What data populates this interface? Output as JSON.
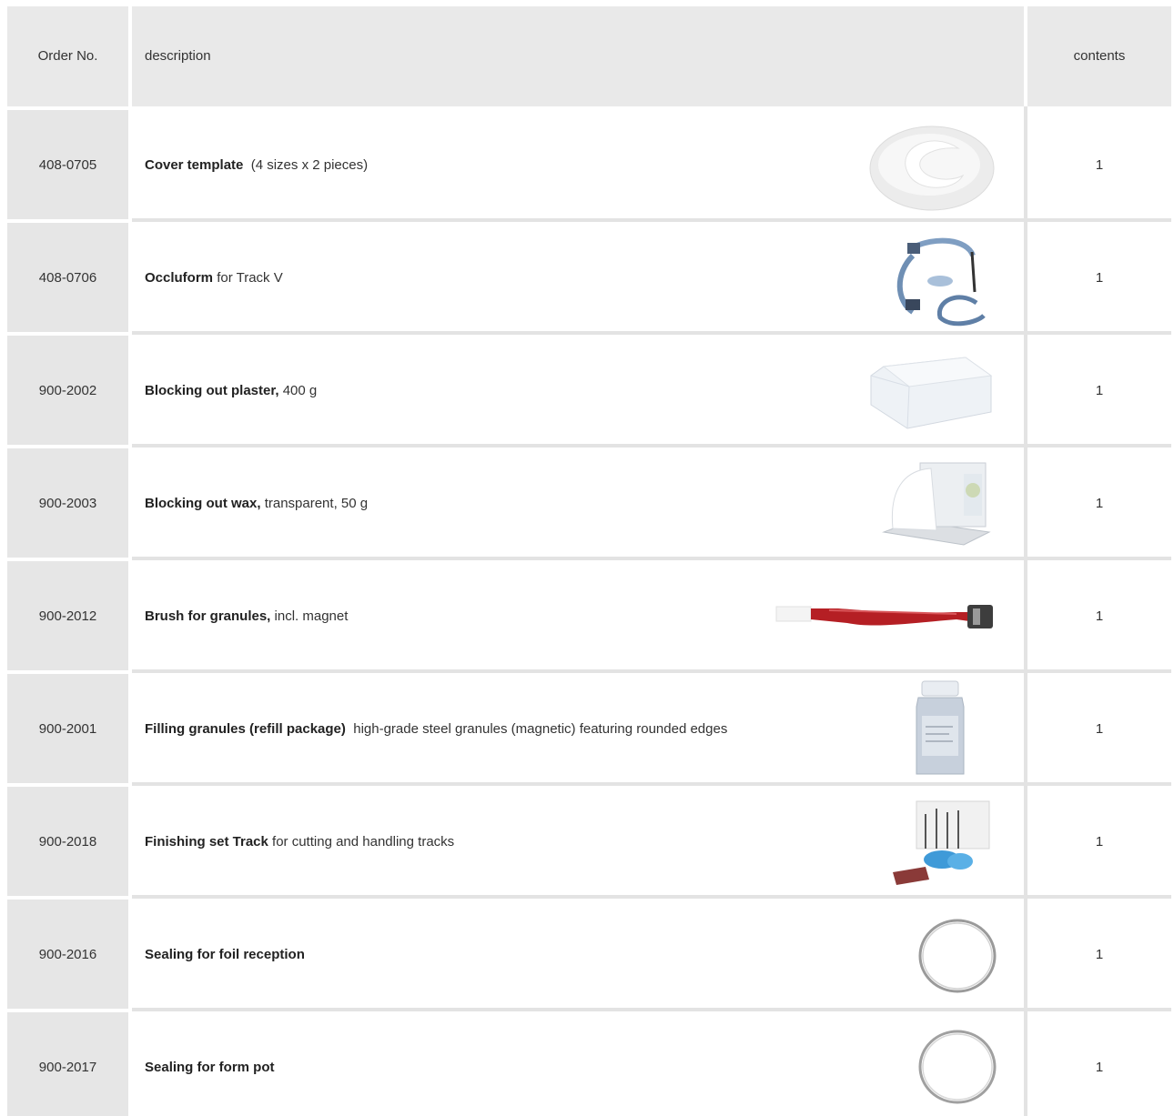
{
  "header": {
    "order_no": "Order No.",
    "description": "description",
    "contents": "contents"
  },
  "rows": [
    {
      "order": "408-0705",
      "name": "Cover template",
      "detail": "(4 sizes x 2 pieces)",
      "qty": "1",
      "image": "cover-template-image"
    },
    {
      "order": "408-0706",
      "name": "Occluform",
      "detail": "for Track V",
      "qty": "1",
      "image": "occluform-image"
    },
    {
      "order": "900-2002",
      "name": "Blocking out plaster,",
      "detail": "400 g",
      "qty": "1",
      "image": "plaster-image"
    },
    {
      "order": "900-2003",
      "name": "Blocking out wax,",
      "detail": "transparent, 50 g",
      "qty": "1",
      "image": "wax-image"
    },
    {
      "order": "900-2012",
      "name": "Brush for granules,",
      "detail": "incl. magnet",
      "qty": "1",
      "image": "brush-image"
    },
    {
      "order": "900-2001",
      "name": "Filling granules (refill package)",
      "detail": "high-grade steel granules (magnetic) featuring rounded edges",
      "qty": "1",
      "image": "granules-bottle-image"
    },
    {
      "order": "900-2018",
      "name": "Finishing set Track",
      "detail": "for cutting and handling tracks",
      "qty": "1",
      "image": "finishing-set-image"
    },
    {
      "order": "900-2016",
      "name": "Sealing for foil reception",
      "detail": "",
      "qty": "1",
      "image": "sealing-ring-image"
    },
    {
      "order": "900-2017",
      "name": "Sealing for form pot",
      "detail": "",
      "qty": "1",
      "image": "sealing-ring-image"
    }
  ]
}
